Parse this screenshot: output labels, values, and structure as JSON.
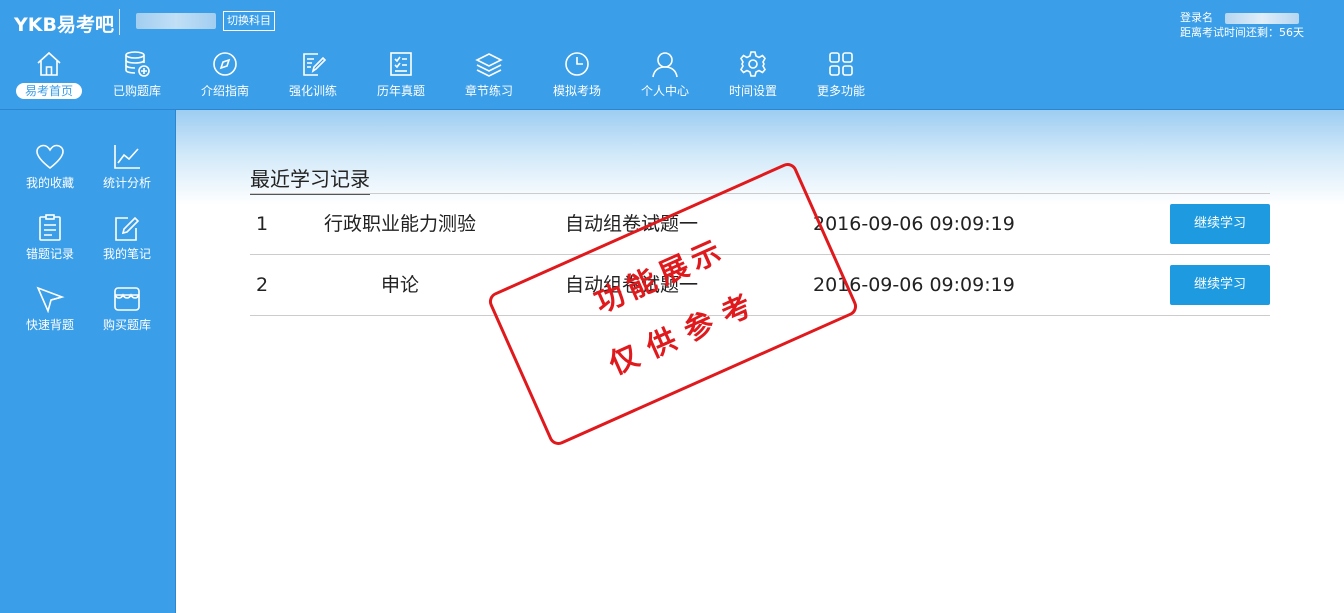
{
  "header": {
    "logo": "YKB易考吧",
    "switch_label": "切换科目",
    "login_label": "登录名",
    "countdown": "距离考试时间还剩：56天"
  },
  "nav": [
    {
      "label": "易考首页",
      "icon": "home-icon",
      "active": true
    },
    {
      "label": "已购题库",
      "icon": "database-add-icon"
    },
    {
      "label": "介绍指南",
      "icon": "compass-icon"
    },
    {
      "label": "强化训练",
      "icon": "edit-document-icon"
    },
    {
      "label": "历年真题",
      "icon": "checklist-icon"
    },
    {
      "label": "章节练习",
      "icon": "layers-icon"
    },
    {
      "label": "模拟考场",
      "icon": "clock-icon"
    },
    {
      "label": "个人中心",
      "icon": "user-icon"
    },
    {
      "label": "时间设置",
      "icon": "gear-icon"
    },
    {
      "label": "更多功能",
      "icon": "grid-icon"
    }
  ],
  "sidebar": [
    {
      "label": "我的收藏",
      "icon": "heart-icon"
    },
    {
      "label": "统计分析",
      "icon": "line-chart-icon"
    },
    {
      "label": "错题记录",
      "icon": "clipboard-icon"
    },
    {
      "label": "我的笔记",
      "icon": "pencil-note-icon"
    },
    {
      "label": "快速背题",
      "icon": "paper-plane-icon"
    },
    {
      "label": "购买题库",
      "icon": "store-icon"
    }
  ],
  "main": {
    "title": "最近学习记录",
    "rows": [
      {
        "index": "1",
        "subject": "行政职业能力测验",
        "paper": "自动组卷试题一",
        "time": "2016-09-06 09:09:19",
        "action": "继续学习"
      },
      {
        "index": "2",
        "subject": "申论",
        "paper": "自动组卷试题一",
        "time": "2016-09-06 09:09:19",
        "action": "继续学习"
      }
    ]
  },
  "stamp": {
    "line1": "功能展示",
    "line2": "仅供参考",
    "color": "#e0191d"
  },
  "colors": {
    "primary": "#3a9ee8",
    "button": "#1e9be0"
  }
}
